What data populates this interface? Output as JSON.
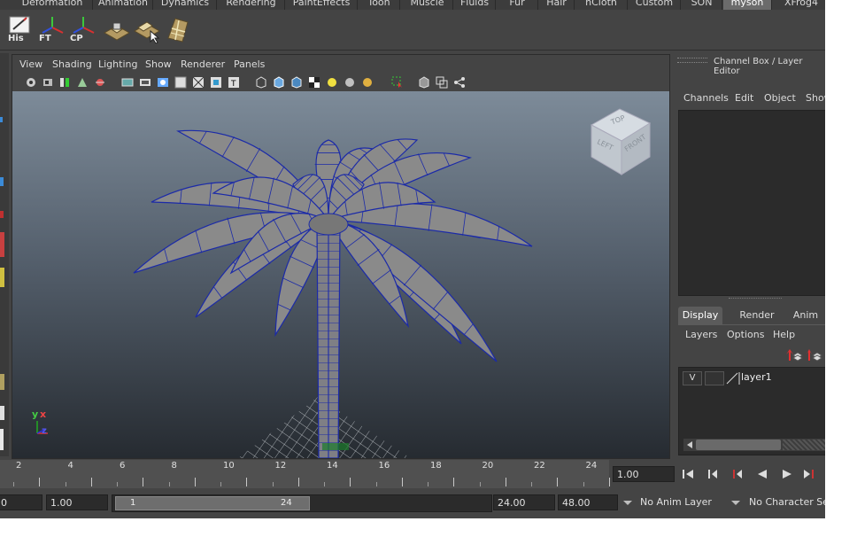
{
  "shelf_tabs": [
    {
      "label": "Deformation"
    },
    {
      "label": "Animation"
    },
    {
      "label": "Dynamics"
    },
    {
      "label": "Rendering"
    },
    {
      "label": "PaintEffects"
    },
    {
      "label": "Toon"
    },
    {
      "label": "Muscle"
    },
    {
      "label": "Fluids"
    },
    {
      "label": "Fur"
    },
    {
      "label": "Hair"
    },
    {
      "label": "nCloth"
    },
    {
      "label": "Custom"
    },
    {
      "label": "SON"
    },
    {
      "label": "myson"
    },
    {
      "label": "XFrog4"
    }
  ],
  "active_shelf_tab": "myson",
  "shelf_buttons": [
    {
      "label": "His",
      "icon": "history-pencil-icon"
    },
    {
      "label": "FT",
      "icon": "freeze-transform-axes-icon"
    },
    {
      "label": "CP",
      "icon": "center-pivot-axes-icon"
    },
    {
      "label": "",
      "icon": "box-plane-icon"
    },
    {
      "label": "",
      "icon": "plane-select-icon"
    },
    {
      "label": "",
      "icon": "grid-plane-icon"
    }
  ],
  "panel_menu": [
    "View",
    "Shading",
    "Lighting",
    "Show",
    "Renderer",
    "Panels"
  ],
  "view_cube": {
    "top": "TOP",
    "left": "LEFT",
    "front": "FRONT"
  },
  "axis_indicator": {
    "y": "y",
    "x": "x",
    "z": "z"
  },
  "channel_box": {
    "title": "Channel Box / Layer Editor",
    "menus": [
      "Channels",
      "Edit",
      "Object",
      "Show"
    ]
  },
  "layer_editor": {
    "tabs": [
      "Display",
      "Render",
      "Anim"
    ],
    "active_tab": "Display",
    "menus": [
      "Layers",
      "Options",
      "Help"
    ],
    "layers": [
      {
        "visibility": "V",
        "name": "layer1"
      }
    ]
  },
  "timeline": {
    "ticks": [
      "2",
      "4",
      "6",
      "8",
      "10",
      "12",
      "14",
      "16",
      "18",
      "20",
      "22",
      "24"
    ],
    "current_frame": "1.00"
  },
  "range_slider": {
    "start_time": "0",
    "playback_start": "1.00",
    "range_start": "1",
    "range_end": "24",
    "playback_end": "24.00",
    "end_time": "48.00",
    "anim_layer": "No Anim Layer",
    "character_set": "No Character Set"
  },
  "colors": {
    "ui_bg": "#444444",
    "viewport_top": "#7d8b99",
    "viewport_bottom": "#262b31",
    "wireframe": "#1b2aa8",
    "mesh": "#8a8a8a"
  }
}
